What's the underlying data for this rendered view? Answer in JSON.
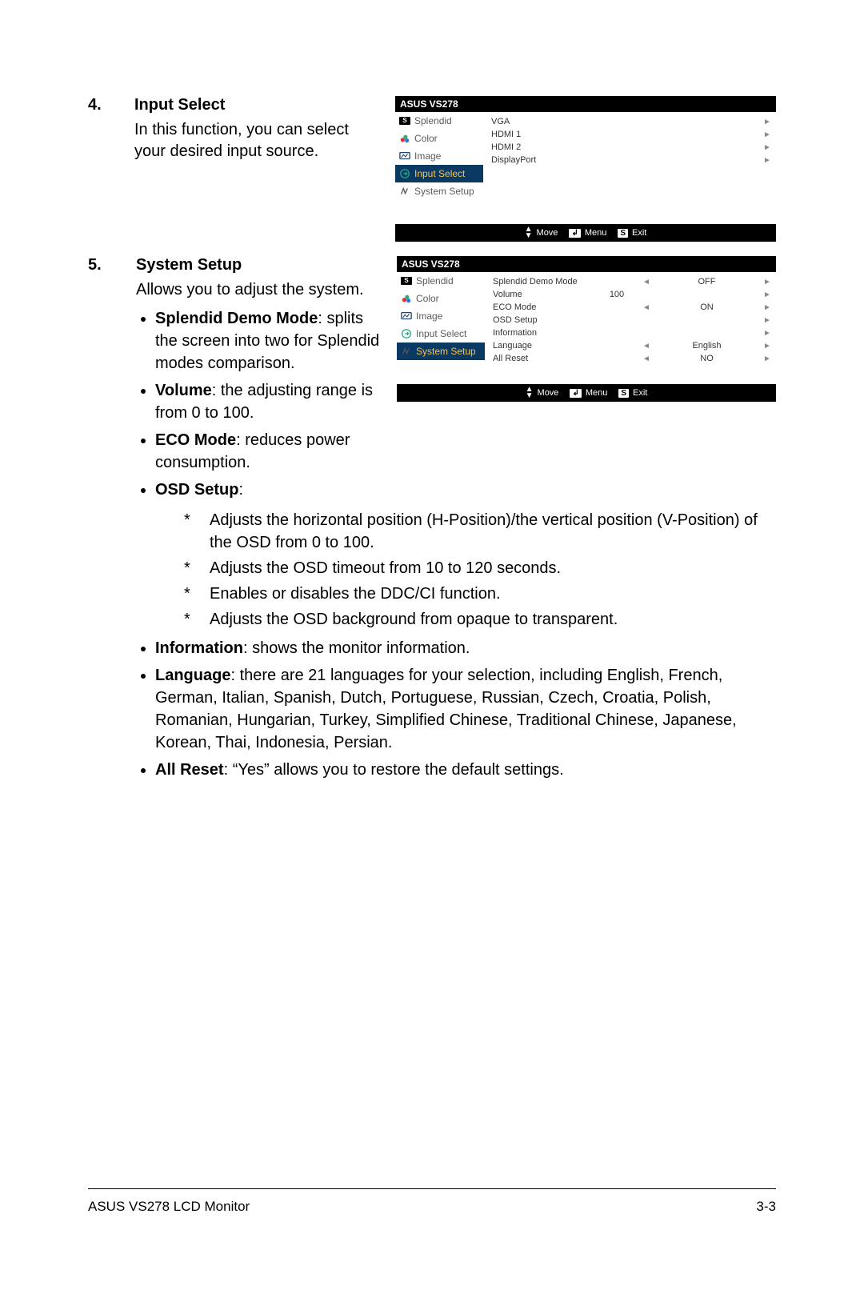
{
  "sections": [
    {
      "num": "4.",
      "title": "Input Select",
      "desc": "In this function, you can select your desired input source."
    },
    {
      "num": "5.",
      "title": "System Setup",
      "desc": "Allows you to adjust the system."
    }
  ],
  "bullets5_left": [
    {
      "bold": "Splendid Demo Mode",
      "rest": ": splits the screen into two for Splendid modes comparison."
    },
    {
      "bold": "Volume",
      "rest": ": the adjusting range is from 0 to 100."
    },
    {
      "bold": "ECO Mode",
      "rest": ": reduces power consumption."
    },
    {
      "bold": "OSD Setup",
      "rest": ":"
    }
  ],
  "osd_stars": [
    "Adjusts the horizontal position (H-Position)/the vertical position (V-Position) of the OSD from 0 to 100.",
    "Adjusts the OSD timeout from 10 to 120 seconds.",
    "Enables or disables the DDC/CI function.",
    "Adjusts the OSD background from opaque to transparent."
  ],
  "bullets5_rest": [
    {
      "bold": "Information",
      "rest": ": shows the monitor information."
    },
    {
      "bold": "Language",
      "rest": ": there are 21 languages for your selection, including English, French, German, Italian, Spanish, Dutch, Portuguese, Russian, Czech, Croatia, Polish, Romanian, Hungarian, Turkey, Simplified Chinese, Traditional Chinese, Japanese, Korean, Thai, Indonesia, Persian."
    },
    {
      "bold": "All Reset",
      "rest": ": “Yes” allows you to restore the default settings."
    }
  ],
  "osd_shared": {
    "header": "ASUS VS278",
    "side": [
      "Splendid",
      "Color",
      "Image",
      "Input Select",
      "System Setup"
    ],
    "footer": {
      "move": "Move",
      "menu": "Menu",
      "exit": "Exit",
      "menu_badge": "↲",
      "exit_badge": "S"
    }
  },
  "osd1": {
    "active_index": 3,
    "options": [
      {
        "label": "VGA"
      },
      {
        "label": "HDMI 1"
      },
      {
        "label": "HDMI 2"
      },
      {
        "label": "DisplayPort"
      }
    ]
  },
  "osd2": {
    "active_index": 4,
    "options": [
      {
        "label": "Splendid Demo Mode",
        "value": "OFF",
        "arrows": true
      },
      {
        "label": "Volume",
        "mid": "100"
      },
      {
        "label": "ECO Mode",
        "value": "ON",
        "arrows": true
      },
      {
        "label": "OSD Setup"
      },
      {
        "label": "Information"
      },
      {
        "label": "Language",
        "value": "English",
        "arrows": true
      },
      {
        "label": "All Reset",
        "value": "NO",
        "arrows": true
      }
    ]
  },
  "footer": {
    "left": "ASUS VS278 LCD Monitor",
    "right": "3-3"
  }
}
